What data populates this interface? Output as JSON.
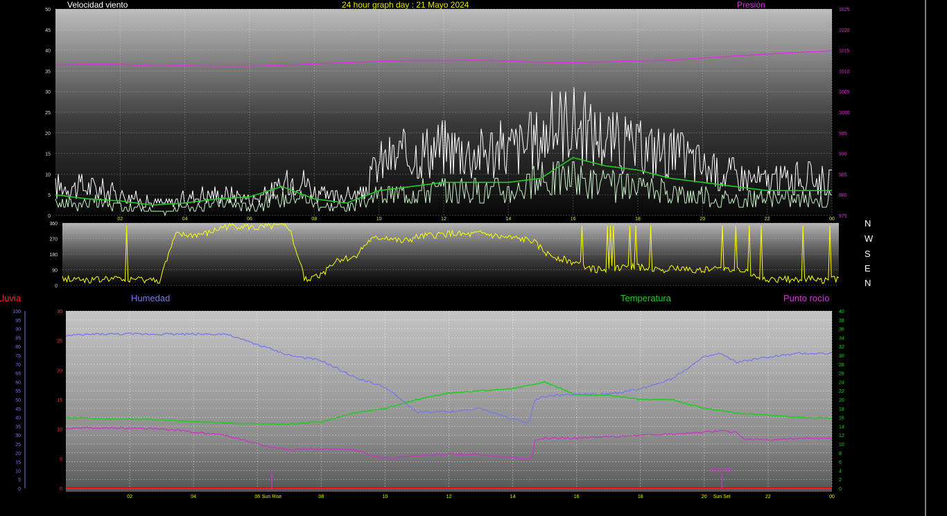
{
  "header": {
    "wind_label": "Velocidad viento",
    "graph_title": "24 hour graph day : 21 Mayo 2024",
    "pressure_label": "Presión"
  },
  "lower_header": {
    "rain_label": "Lluvia",
    "humidity_label": "Humedad",
    "temperature_label": "Temperatura",
    "dewpoint_label": "Punto rocío"
  },
  "compass": [
    "N",
    "W",
    "S",
    "E",
    "N"
  ],
  "colors": {
    "wind_gust": "#ffffff",
    "wind_avg": "#c8f0c8",
    "wind_avg_smooth": "#22cc22",
    "pressure": "#dd33dd",
    "direction": "#ffff00",
    "humidity": "#7777ee",
    "temperature": "#22cc22",
    "dewpoint": "#cc33cc",
    "rain": "#ff0000"
  },
  "chart_data": [
    {
      "type": "line",
      "name": "wind-and-pressure",
      "x_ticks": [
        "02",
        "04",
        "06",
        "08",
        "10",
        "12",
        "14",
        "16",
        "18",
        "20",
        "22",
        "00"
      ],
      "ylim_left": [
        0,
        50
      ],
      "yticks_left": [
        "0",
        "5",
        "10",
        "15",
        "20",
        "25",
        "30",
        "35",
        "40",
        "45",
        "50"
      ],
      "ylim_right": [
        975,
        1025
      ],
      "yticks_right": [
        "975",
        "980",
        "985",
        "990",
        "995",
        "1000",
        "1005",
        "1010",
        "1015",
        "1020",
        "1025"
      ],
      "grid": true,
      "series": [
        {
          "name": "Velocidad viento",
          "key": "gust",
          "x": [
            0,
            0.5,
            1,
            1.5,
            2,
            2.5,
            3,
            3.5,
            4,
            4.5,
            5,
            5.5,
            6,
            6.5,
            7,
            7.5,
            8,
            8.5,
            9,
            9.5,
            10,
            10.5,
            11,
            11.5,
            12,
            12.5,
            13,
            13.5,
            14,
            14.5,
            15,
            15.5,
            16,
            16.5,
            17,
            17.5,
            18,
            18.5,
            19,
            19.5,
            20,
            20.5,
            21,
            21.5,
            22,
            22.5,
            23,
            23.5,
            24
          ],
          "y": [
            7,
            7,
            7,
            6,
            5,
            4,
            3,
            3,
            4,
            5,
            5,
            5,
            4,
            5,
            7,
            10,
            6,
            4,
            5,
            5,
            13,
            14,
            15,
            16,
            17,
            16,
            15,
            16,
            16,
            17,
            19,
            22,
            23,
            20,
            19,
            17,
            16,
            16,
            15,
            14,
            12,
            10,
            10,
            9,
            8,
            9,
            9,
            9,
            8
          ]
        },
        {
          "name": "",
          "key": "avg",
          "x": [
            0,
            0.5,
            1,
            1.5,
            2,
            2.5,
            3,
            3.5,
            4,
            4.5,
            5,
            5.5,
            6,
            6.5,
            7,
            7.5,
            8,
            8.5,
            9,
            9.5,
            10,
            10.5,
            11,
            11.5,
            12,
            12.5,
            13,
            13.5,
            14,
            14.5,
            15,
            15.5,
            16,
            16.5,
            17,
            17.5,
            18,
            18.5,
            19,
            19.5,
            20,
            20.5,
            21,
            21.5,
            22,
            22.5,
            23,
            23.5,
            24
          ],
          "y": [
            3,
            3,
            3,
            3,
            2,
            2,
            1,
            1,
            2,
            2,
            3,
            3,
            2,
            3,
            4,
            5,
            3,
            2,
            2,
            3,
            5,
            5,
            6,
            6,
            6,
            6,
            6,
            6,
            6,
            7,
            8,
            9,
            9,
            8,
            7,
            7,
            6,
            6,
            6,
            5,
            5,
            4,
            4,
            4,
            4,
            4,
            4,
            4,
            4
          ]
        },
        {
          "name": "",
          "key": "avg_smooth",
          "x": [
            0,
            1,
            2,
            3,
            4,
            5,
            6,
            7,
            8,
            9,
            10,
            11,
            12,
            13,
            14,
            15,
            16,
            17,
            18,
            19,
            20,
            21,
            22,
            23,
            24
          ],
          "y": [
            5,
            4,
            3.5,
            2.5,
            3,
            4,
            4.5,
            7,
            4,
            3,
            6,
            7,
            8,
            8,
            8,
            9,
            14,
            12,
            11,
            9,
            8,
            7,
            6,
            6,
            6
          ]
        },
        {
          "name": "Presión",
          "key": "pressure",
          "x": [
            0,
            1,
            2,
            3,
            4,
            5,
            6,
            7,
            8,
            9,
            10,
            11,
            12,
            13,
            14,
            15,
            16,
            17,
            18,
            19,
            20,
            21,
            22,
            23,
            24
          ],
          "y": [
            1011.5,
            1011.6,
            1011.6,
            1011.2,
            1011.3,
            1011.1,
            1011.1,
            1011.4,
            1011.7,
            1012.0,
            1012.3,
            1012.5,
            1012.5,
            1012.6,
            1012.4,
            1012.1,
            1012.0,
            1012.2,
            1012.4,
            1012.6,
            1013.1,
            1013.6,
            1014.1,
            1014.5,
            1014.9
          ]
        }
      ]
    },
    {
      "type": "line",
      "name": "wind-direction",
      "ylim": [
        0,
        360
      ],
      "yticks": [
        "0",
        "90",
        "180",
        "270",
        "360"
      ],
      "series": [
        {
          "name": "",
          "key": "direction",
          "x": [
            0,
            0.5,
            1,
            1.5,
            2,
            2.5,
            3,
            3.5,
            4,
            4.5,
            5,
            5.5,
            6,
            6.5,
            7,
            7.5,
            8,
            8.5,
            9,
            9.5,
            10,
            10.5,
            11,
            11.5,
            12,
            12.5,
            13,
            13.5,
            14,
            14.5,
            15,
            15.5,
            16,
            16.5,
            17,
            17.5,
            18,
            18.5,
            19,
            19.5,
            20,
            20.5,
            21,
            21.5,
            22,
            22.5,
            23,
            23.5,
            24
          ],
          "y": [
            40,
            35,
            30,
            40,
            30,
            35,
            30,
            290,
            290,
            300,
            340,
            345,
            330,
            340,
            340,
            30,
            60,
            150,
            160,
            260,
            280,
            250,
            280,
            290,
            300,
            290,
            300,
            280,
            270,
            260,
            180,
            150,
            120,
            90,
            100,
            110,
            100,
            90,
            100,
            90,
            90,
            100,
            90,
            40,
            30,
            35,
            40,
            30,
            40
          ]
        }
      ]
    },
    {
      "type": "line",
      "name": "humidity-temperature-dewpoint",
      "ylim_hum": [
        0,
        100
      ],
      "yticks_hum": [
        "0",
        "5",
        "10",
        "15",
        "20",
        "25",
        "30",
        "35",
        "40",
        "45",
        "50",
        "55",
        "60",
        "65",
        "70",
        "75",
        "80",
        "85",
        "90",
        "95",
        "100"
      ],
      "ylim_dew": [
        0,
        30
      ],
      "yticks_dew": [
        "0",
        "5",
        "10",
        "15",
        "20",
        "25",
        "30"
      ],
      "ylim_temp": [
        0,
        40
      ],
      "yticks_temp": [
        "0",
        "2",
        "4",
        "6",
        "8",
        "10",
        "12",
        "14",
        "16",
        "18",
        "20",
        "22",
        "24",
        "26",
        "28",
        "30",
        "32",
        "34",
        "36",
        "38",
        "40"
      ],
      "x_ticks": [
        "02",
        "04",
        "06",
        "08",
        "10",
        "12",
        "14",
        "16",
        "18",
        "20",
        "22",
        "00"
      ],
      "annotations": [
        "Sun Rise",
        "Sun Set"
      ],
      "series": [
        {
          "name": "Humedad",
          "key": "humidity",
          "x": [
            0,
            1,
            2,
            3,
            4,
            5,
            6,
            7,
            8,
            9,
            10,
            11,
            12,
            13,
            14,
            14.5,
            14.7,
            15,
            16,
            17,
            18,
            19,
            20,
            20.5,
            21,
            22,
            23,
            24
          ],
          "y": [
            86,
            87,
            87,
            87,
            87,
            87,
            81,
            75,
            72,
            63,
            57,
            43,
            43,
            45,
            39,
            37,
            50,
            52,
            53,
            53,
            56,
            62,
            74,
            76,
            71,
            74,
            76,
            76
          ]
        },
        {
          "name": "Temperatura",
          "key": "temperature",
          "x": [
            0,
            1,
            2,
            3,
            4,
            5,
            6,
            7,
            8,
            9,
            10,
            11,
            12,
            13,
            14,
            15,
            16,
            17,
            18,
            19,
            20,
            21,
            22,
            23,
            24
          ],
          "y": [
            16,
            15.7,
            15.6,
            15.5,
            15,
            14.8,
            14.5,
            14.5,
            15,
            17,
            18,
            20,
            21.5,
            22,
            22.5,
            24,
            21,
            21,
            20,
            20,
            18,
            17,
            16.5,
            16,
            15.8
          ]
        },
        {
          "name": "Punto rocío",
          "key": "dewpoint",
          "x": [
            0,
            1,
            2,
            3,
            4,
            5,
            6,
            7,
            8,
            9,
            10,
            11,
            12,
            13,
            14,
            14.6,
            14.7,
            15,
            16,
            17,
            18,
            19,
            20,
            20.5,
            21,
            21.3,
            22,
            23,
            24
          ],
          "y": [
            10.2,
            10.2,
            10.2,
            10.1,
            9.5,
            9,
            7.5,
            6.5,
            6.7,
            6.5,
            5,
            5.5,
            5.8,
            5.7,
            5.2,
            5,
            8.2,
            8.5,
            8.5,
            8.7,
            9,
            9.2,
            9.5,
            9.7,
            9.5,
            8.3,
            8.2,
            8.4,
            8.4
          ]
        },
        {
          "name": "Lluvia",
          "key": "rain",
          "x": [
            0,
            24
          ],
          "y": [
            0,
            0
          ]
        }
      ]
    }
  ]
}
